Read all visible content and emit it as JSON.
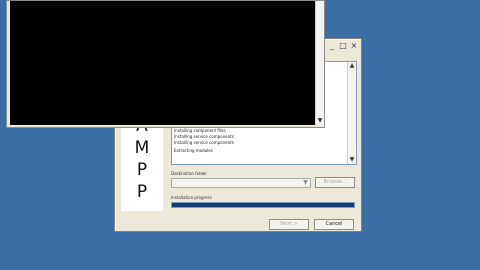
{
  "installer": {
    "title_buttons": [
      "_",
      "□",
      "×"
    ],
    "side_letters": [
      "A",
      "M",
      "P",
      "P"
    ],
    "log_lines": [
      "Installing component files",
      "Installing service components",
      "Installing service components",
      "Extracting modules"
    ],
    "destination_label": "Destination folder",
    "destination_value": "",
    "browse_label": "Browse...",
    "progress_label": "Installation progress",
    "progress_value": 1.0,
    "next_label": "Next >",
    "cancel_label": "Cancel"
  },
  "console_window": {
    "scroll_up": "▲",
    "scroll_down": "▼"
  }
}
